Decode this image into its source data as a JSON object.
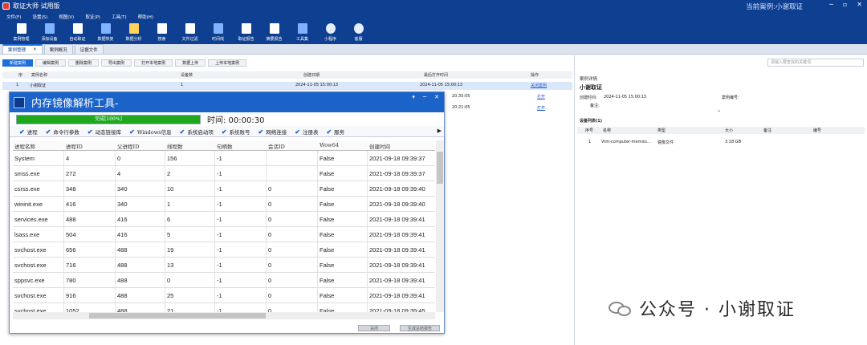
{
  "app": {
    "title": "取证大师 试用版",
    "current_case_label": "当前案例:小谢取证",
    "window_controls": [
      "─",
      "▫",
      "✕"
    ]
  },
  "menu": [
    "文件(F)",
    "设置(S)",
    "视图(V)",
    "取证(P)",
    "工具(T)",
    "帮助(H)"
  ],
  "toolbar": [
    {
      "label": "案例管理",
      "icon": "case-manage-icon"
    },
    {
      "label": "添加设备",
      "icon": "add-device-icon"
    },
    {
      "label": "自动取证",
      "icon": "auto-forensic-icon"
    },
    {
      "label": "数据恢复",
      "icon": "data-recovery-icon"
    },
    {
      "label": "数据分析",
      "icon": "data-analysis-icon"
    },
    {
      "label": "搜索",
      "icon": "search-icon"
    },
    {
      "label": "文件过滤",
      "icon": "file-filter-icon"
    },
    {
      "label": "时间线",
      "icon": "timeline-icon"
    },
    {
      "label": "取证报告",
      "icon": "report-icon"
    },
    {
      "label": "摘要报告",
      "icon": "summary-report-icon"
    },
    {
      "label": "工具集",
      "icon": "toolset-icon"
    },
    {
      "label": "小程序",
      "icon": "mini-program-icon"
    },
    {
      "label": "客服",
      "icon": "customer-service-icon"
    }
  ],
  "tabs": [
    {
      "label": "案例管理",
      "active": true
    },
    {
      "label": "案例概况",
      "active": false
    },
    {
      "label": "证据文件",
      "active": false
    }
  ],
  "actions": [
    "新建案例",
    "编辑案例",
    "删除案例",
    "导出案例",
    "打开本地案例",
    "数据上传",
    "上传本地案例"
  ],
  "search": {
    "placeholder": "请输入要查找的关键词"
  },
  "case_table": {
    "headers": [
      "序",
      "案例名称",
      "设备数",
      "创建日期",
      "最后打开时间",
      "操作"
    ],
    "rows": [
      {
        "no": "1",
        "name": "小谢取证",
        "devices": "1",
        "created": "2024-11-05 15:00:13",
        "last_open": "2024-11-05 15:00:13",
        "action": "关闭案例"
      },
      {
        "no": "",
        "name": "",
        "devices": "",
        "created": "",
        "last_open": "20:35:05",
        "action": "打开"
      },
      {
        "no": "",
        "name": "",
        "devices": "",
        "created": "",
        "last_open": "20:21:05",
        "action": "打开"
      }
    ]
  },
  "case_detail": {
    "header": "案例详情",
    "case_name": "小谢取证",
    "created_label": "创建时间:",
    "created_value": "2024-11-05 15:00:13",
    "case_no_label": "案例编号:",
    "remark_label": "备注:",
    "device_list_label": "设备列表(1)",
    "device_headers": [
      "序号",
      "名称",
      "类型",
      "大小",
      "备注",
      "编号"
    ],
    "devices": [
      {
        "no": "1",
        "name": "Vtm-computer-memdu...",
        "type": "镜像文件",
        "size": "3.18 GB",
        "remark": "",
        "id": ""
      }
    ]
  },
  "dialog": {
    "title": "内存镜像解析工具-",
    "progress_text": "完成[100%]",
    "progress": 1.0,
    "timer": "时间: 00:00:30",
    "tabs": [
      "进程",
      "命令行参数",
      "动态链接库",
      "Windows信息",
      "系统启动项",
      "系统账号",
      "网络连接",
      "注册表",
      "服务"
    ],
    "columns": [
      "进程名称",
      "进程ID",
      "父进程ID",
      "线程数",
      "句柄数",
      "会话ID",
      "Wow64",
      "创建时间"
    ],
    "rows": [
      [
        "System",
        "4",
        "0",
        "156",
        "-1",
        "",
        "False",
        "2021-09-18 09:39:37"
      ],
      [
        "smss.exe",
        "272",
        "4",
        "2",
        "-1",
        "",
        "False",
        "2021-09-18 09:39:37"
      ],
      [
        "csrss.exe",
        "348",
        "340",
        "10",
        "-1",
        "0",
        "False",
        "2021-09-18 09:39:40"
      ],
      [
        "wininit.exe",
        "416",
        "340",
        "1",
        "-1",
        "0",
        "False",
        "2021-09-18 09:39:40"
      ],
      [
        "services.exe",
        "488",
        "416",
        "6",
        "-1",
        "0",
        "False",
        "2021-09-18 09:39:41"
      ],
      [
        "lsass.exe",
        "504",
        "416",
        "5",
        "-1",
        "0",
        "False",
        "2021-09-18 09:39:41"
      ],
      [
        "svchost.exe",
        "656",
        "488",
        "19",
        "-1",
        "0",
        "False",
        "2021-09-18 09:39:41"
      ],
      [
        "svchost.exe",
        "716",
        "488",
        "13",
        "-1",
        "0",
        "False",
        "2021-09-18 09:39:41"
      ],
      [
        "sppsvc.exe",
        "780",
        "488",
        "0",
        "-1",
        "0",
        "False",
        "2021-09-18 09:39:41"
      ],
      [
        "svchost.exe",
        "916",
        "488",
        "25",
        "-1",
        "0",
        "False",
        "2021-09-18 09:39:41"
      ],
      [
        "svchost.exe",
        "1052",
        "488",
        "21",
        "-1",
        "0",
        "False",
        "2021-09-18 09:39:45"
      ]
    ],
    "buttons": [
      "关闭",
      "生成总结报告"
    ]
  },
  "watermark": {
    "text": "公众号 · 小谢取证",
    "icon": "wechat-icon"
  }
}
